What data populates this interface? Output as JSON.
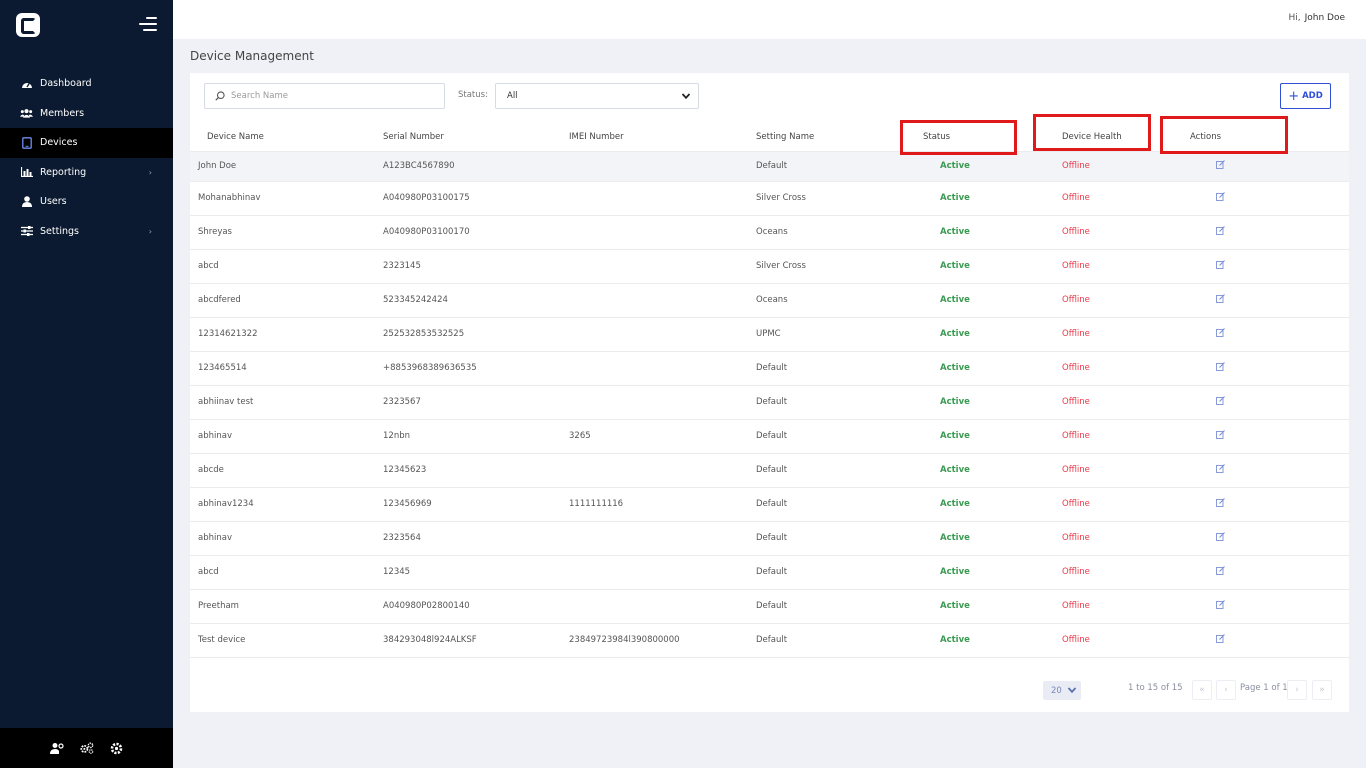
{
  "sidebar": {
    "items": [
      {
        "label": "Dashboard",
        "icon": "dashboard-icon"
      },
      {
        "label": "Members",
        "icon": "members-icon"
      },
      {
        "label": "Devices",
        "icon": "devices-icon",
        "active": true
      },
      {
        "label": "Reporting",
        "icon": "reporting-icon",
        "has_submenu": true
      },
      {
        "label": "Users",
        "icon": "user-icon"
      },
      {
        "label": "Settings",
        "icon": "settings-sliders-icon",
        "has_submenu": true
      }
    ],
    "chevron": "›",
    "footer_icons": [
      "user-settings-icon",
      "gears-icon",
      "gear-icon"
    ]
  },
  "header": {
    "greeting": "Hi,",
    "user_name": "John Doe"
  },
  "page_title": "Device Management",
  "filters": {
    "search_placeholder": "Search Name",
    "status_label": "Status:",
    "status_value": "All",
    "add_label": "ADD"
  },
  "table": {
    "headers": [
      "Device Name",
      "Serial Number",
      "IMEI Number",
      "Setting Name",
      "Status",
      "Device Health",
      "Actions"
    ],
    "rows": [
      [
        "John Doe",
        "A123BC4567890",
        "",
        "Default",
        "Active",
        "Offline"
      ],
      [
        "Mohanabhinav",
        "A040980P03100175",
        "",
        "Silver Cross",
        "Active",
        "Offline"
      ],
      [
        "Shreyas",
        "A040980P03100170",
        "",
        "Oceans",
        "Active",
        "Offline"
      ],
      [
        "abcd",
        "2323145",
        "",
        "Silver Cross",
        "Active",
        "Offline"
      ],
      [
        "abcdfered",
        "523345242424",
        "",
        "Oceans",
        "Active",
        "Offline"
      ],
      [
        "12314621322",
        "252532853532525",
        "",
        "UPMC",
        "Active",
        "Offline"
      ],
      [
        "123465514",
        "+8853968389636535",
        "",
        "Default",
        "Active",
        "Offline"
      ],
      [
        "abhiinav test",
        "2323567",
        "",
        "Default",
        "Active",
        "Offline"
      ],
      [
        "abhinav",
        "12nbn",
        "3265",
        "Default",
        "Active",
        "Offline"
      ],
      [
        "abcde",
        "12345623",
        "",
        "Default",
        "Active",
        "Offline"
      ],
      [
        "abhinav1234",
        "123456969",
        "1111111116",
        "Default",
        "Active",
        "Offline"
      ],
      [
        "abhinav",
        "2323564",
        "",
        "Default",
        "Active",
        "Offline"
      ],
      [
        "abcd",
        "12345",
        "",
        "Default",
        "Active",
        "Offline"
      ],
      [
        "Preetham",
        "A040980P02800140",
        "",
        "Default",
        "Active",
        "Offline"
      ],
      [
        "Test device",
        "384293048l924ALKSF",
        "23849723984l390800000",
        "Default",
        "Active",
        "Offline"
      ]
    ]
  },
  "pagination": {
    "page_size": "20",
    "range_text": "1 to 15 of 15",
    "page_text": "Page 1 of 1",
    "first": "«",
    "prev": "‹",
    "next": "›",
    "last": "»"
  },
  "colors": {
    "sidebar_bg": "#0b1a30",
    "active_status": "#3a9a52",
    "offline_health": "#e8394a",
    "highlight_box": "#e01a1a",
    "add_button": "#2f4fd9"
  }
}
